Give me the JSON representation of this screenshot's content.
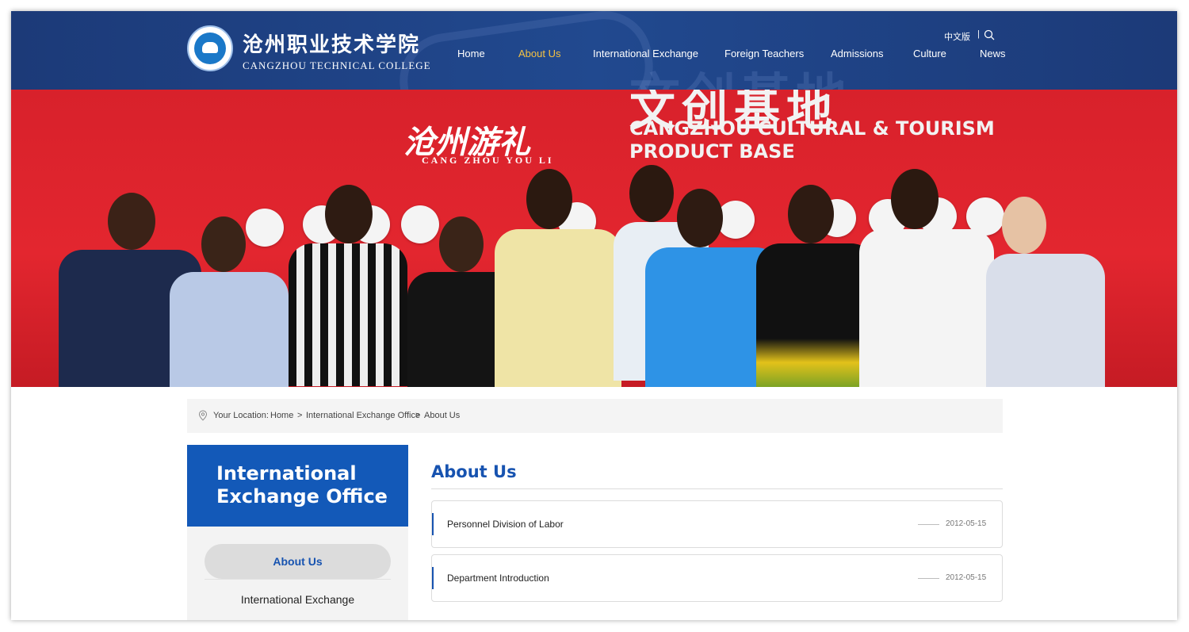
{
  "header": {
    "logo_cn": "沧州职业技术学院",
    "logo_en": "CANGZHOU TECHNICAL COLLEGE",
    "lang_label": "中文版",
    "separator": "|",
    "search_icon": "search-icon",
    "watermark": "文创基地"
  },
  "nav": {
    "items": [
      {
        "label": "Home"
      },
      {
        "label": "About Us",
        "active": true
      },
      {
        "label": "International Exchange"
      },
      {
        "label": "Foreign Teachers"
      },
      {
        "label": "Admissions"
      },
      {
        "label": "Culture"
      },
      {
        "label": "News"
      }
    ]
  },
  "banner": {
    "sign_cn": "沧州游礼",
    "sign_en": "CANG ZHOU YOU LI",
    "big_cn": "文创基地",
    "title_line1": "CANGZHOU CULTURAL & TOURISM",
    "title_line2": "PRODUCT BASE"
  },
  "breadcrumb": {
    "icon": "location-pin-icon",
    "label": "Your Location:",
    "home": "Home",
    "sep1": ">",
    "section": "International Exchange Office",
    "sep2": ">",
    "current": "About Us"
  },
  "sidebar": {
    "title_line1": "International",
    "title_line2": "Exchange Office",
    "items": [
      {
        "label": "About Us",
        "active": true
      },
      {
        "label": "International Exchange"
      }
    ]
  },
  "main": {
    "title": "About Us",
    "articles": [
      {
        "title": "Personnel Division of Labor",
        "date": "2012-05-15"
      },
      {
        "title": "Department Introduction",
        "date": "2012-05-15"
      }
    ]
  },
  "colors": {
    "header_bg": "#1c3a78",
    "nav_active": "#f5c242",
    "accent_blue": "#1753b0",
    "banner_red": "#d8212b"
  }
}
